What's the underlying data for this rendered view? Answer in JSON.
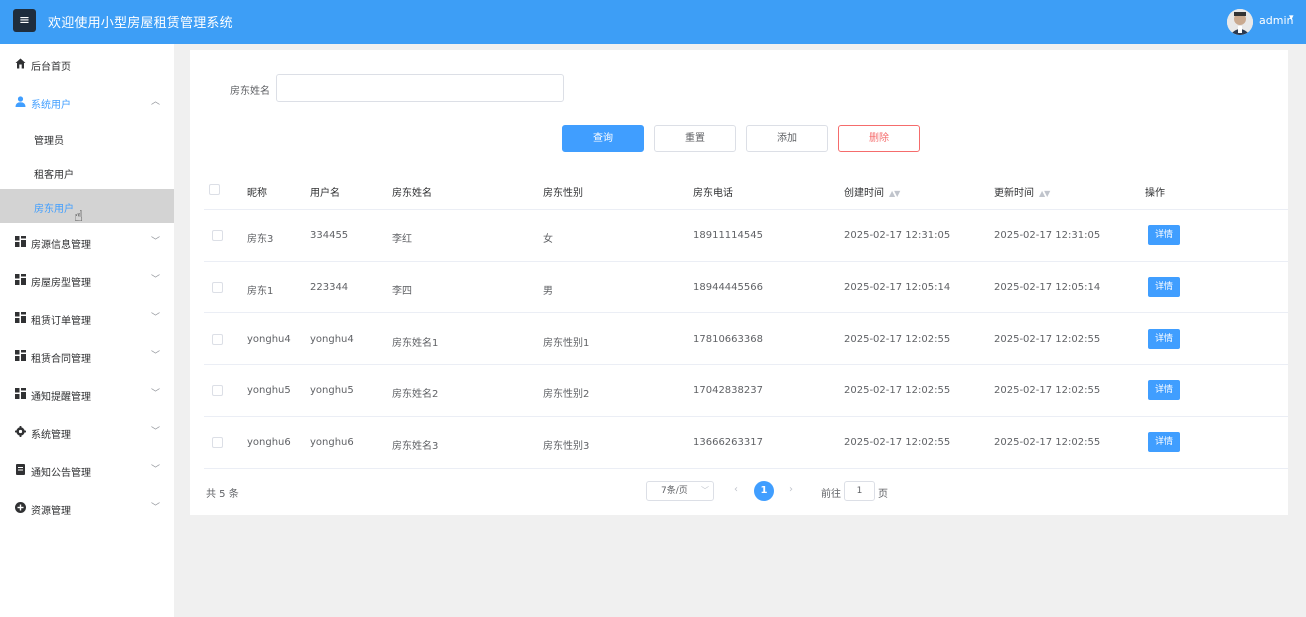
{
  "header": {
    "menu_icon": "hamburger-icon",
    "title": "欢迎使用小型房屋租赁管理系统",
    "user_name": "admin",
    "accent": "#3d9ef6"
  },
  "sidebar": {
    "items": [
      {
        "label": "后台首页",
        "icon": "home-icon"
      },
      {
        "label": "系统用户",
        "icon": "user-icon",
        "expanded": true,
        "children": [
          {
            "label": "管理员"
          },
          {
            "label": "租客用户"
          },
          {
            "label": "房东用户",
            "active": true
          }
        ]
      },
      {
        "label": "房源信息管理",
        "icon": "grid-icon"
      },
      {
        "label": "房屋房型管理",
        "icon": "grid-icon"
      },
      {
        "label": "租赁订单管理",
        "icon": "grid-icon"
      },
      {
        "label": "租赁合同管理",
        "icon": "grid-icon"
      },
      {
        "label": "通知提醒管理",
        "icon": "grid-icon"
      },
      {
        "label": "系统管理",
        "icon": "gear-icon"
      },
      {
        "label": "通知公告管理",
        "icon": "document-icon"
      },
      {
        "label": "资源管理",
        "icon": "plus-circle-icon"
      }
    ]
  },
  "search": {
    "label": "房东姓名",
    "value": ""
  },
  "buttons": {
    "query": "查询",
    "reset": "重置",
    "add": "添加",
    "delete": "删除"
  },
  "table": {
    "headers": [
      "昵称",
      "用户名",
      "房东姓名",
      "房东性别",
      "房东电话",
      "创建时间",
      "更新时间",
      "操作"
    ],
    "sort_icon": "sort-caret-icon",
    "rows": [
      {
        "nickname": "房东3",
        "username": "334455",
        "name": "李红",
        "gender": "女",
        "phone": "18911114545",
        "created": "2025-02-17 12:31:05",
        "updated": "2025-02-17 12:31:05",
        "action": "详情"
      },
      {
        "nickname": "房东1",
        "username": "223344",
        "name": "李四",
        "gender": "男",
        "phone": "18944445566",
        "created": "2025-02-17 12:05:14",
        "updated": "2025-02-17 12:05:14",
        "action": "详情"
      },
      {
        "nickname": "yonghu4",
        "username": "yonghu4",
        "name": "房东姓名1",
        "gender": "房东性别1",
        "phone": "17810663368",
        "created": "2025-02-17 12:02:55",
        "updated": "2025-02-17 12:02:55",
        "action": "详情"
      },
      {
        "nickname": "yonghu5",
        "username": "yonghu5",
        "name": "房东姓名2",
        "gender": "房东性别2",
        "phone": "17042838237",
        "created": "2025-02-17 12:02:55",
        "updated": "2025-02-17 12:02:55",
        "action": "详情"
      },
      {
        "nickname": "yonghu6",
        "username": "yonghu6",
        "name": "房东姓名3",
        "gender": "房东性别3",
        "phone": "13666263317",
        "created": "2025-02-17 12:02:55",
        "updated": "2025-02-17 12:02:55",
        "action": "详情"
      }
    ]
  },
  "pagination": {
    "total": "共 5 条",
    "page_size": "7条/页",
    "current_page": "1",
    "goto_label": "前往",
    "goto_value": "1",
    "goto_suffix": "页"
  },
  "colors": {
    "primary": "#409eff",
    "danger": "#f56c6c",
    "sidebar_active_bg": "#d3d3d3"
  }
}
